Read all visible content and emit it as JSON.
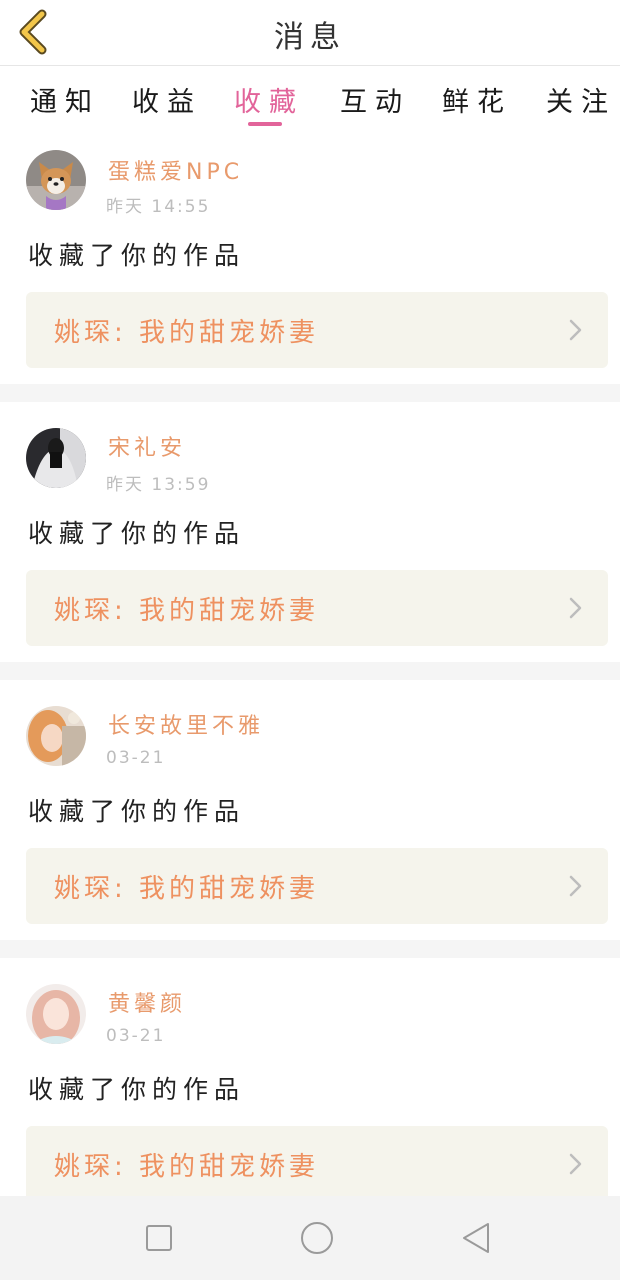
{
  "header": {
    "title": "消息",
    "back_icon": "chevron-left-icon"
  },
  "tabs": [
    {
      "label": "通知",
      "active": false
    },
    {
      "label": "收益",
      "active": false
    },
    {
      "label": "收藏",
      "active": true
    },
    {
      "label": "互动",
      "active": false
    },
    {
      "label": "鲜花",
      "active": false
    },
    {
      "label": "关注",
      "active": false
    }
  ],
  "colors": {
    "accent": "#e2649a",
    "username": "#e89a6c",
    "work_title": "#ee9160",
    "timestamp": "#bdbdbd",
    "work_bg": "#f5f4ec",
    "back_icon": "#f2c64a"
  },
  "messages": [
    {
      "username": "蛋糕爱NPC",
      "time": "昨天 14:55",
      "action": "收藏了你的作品",
      "work_title": "姚琛: 我的甜宠娇妻"
    },
    {
      "username": "宋礼安",
      "time": "昨天 13:59",
      "action": "收藏了你的作品",
      "work_title": "姚琛: 我的甜宠娇妻"
    },
    {
      "username": "长安故里不雅",
      "time": "03-21",
      "action": "收藏了你的作品",
      "work_title": "姚琛: 我的甜宠娇妻"
    },
    {
      "username": "黄馨颜",
      "time": "03-21",
      "action": "收藏了你的作品",
      "work_title": "姚琛: 我的甜宠娇妻"
    }
  ],
  "navbar": {
    "icons": [
      "recent-apps-icon",
      "home-icon",
      "back-icon"
    ]
  }
}
